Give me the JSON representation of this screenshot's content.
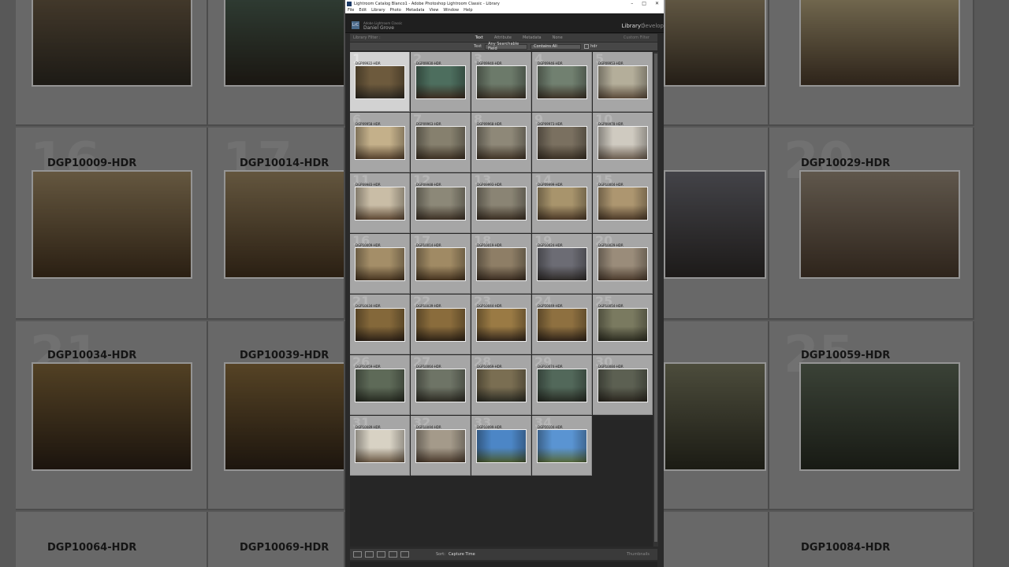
{
  "window": {
    "title": "Lightroom Catalog Blanco1 - Adobe Photoshop Lightroom Classic - Library",
    "controls": [
      "–",
      "□",
      "✕"
    ]
  },
  "menu": [
    "File",
    "Edit",
    "Library",
    "Photo",
    "Metadata",
    "View",
    "Window",
    "Help"
  ],
  "identity": {
    "logo": "LrC",
    "brand": "Adobe Lightroom Classic",
    "user": "Daniel Grove",
    "modules": [
      "Library",
      "|",
      "Develop"
    ]
  },
  "filter_bar": {
    "label": "Library Filter :",
    "tabs": [
      "Text",
      "Attribute",
      "Metadata",
      "None"
    ],
    "active_tab": "Text",
    "preset": "Custom Filter"
  },
  "text_filter": {
    "label": "Text",
    "field": "Any Searchable Field",
    "rule": "Contains All",
    "query": "hdr"
  },
  "grid": {
    "items": [
      {
        "n": "1",
        "name": "DGP09922-HDR",
        "c1": "#6d5a3d",
        "c2": "#2f2a22",
        "sel": true
      },
      {
        "n": "2",
        "name": "DGP09930-HDR",
        "c1": "#4d6e5e",
        "c2": "#3c2c20"
      },
      {
        "n": "3",
        "name": "DGP09940-HDR",
        "c1": "#6c7a6a",
        "c2": "#3e3428"
      },
      {
        "n": "4",
        "name": "DGP09946-HDR",
        "c1": "#718070",
        "c2": "#3c3226"
      },
      {
        "n": "5",
        "name": "DGP09953-HDR",
        "c1": "#b4ae9a",
        "c2": "#5a4a3a"
      },
      {
        "n": "6",
        "name": "DGP09958-HDR",
        "c1": "#c4b08a",
        "c2": "#54402c"
      },
      {
        "n": "7",
        "name": "DGP09963-HDR",
        "c1": "#86806e",
        "c2": "#3c3022"
      },
      {
        "n": "8",
        "name": "DGP09968-HDR",
        "c1": "#8e8878",
        "c2": "#403426"
      },
      {
        "n": "9",
        "name": "DGP09973-HDR",
        "c1": "#7a7060",
        "c2": "#3a3024"
      },
      {
        "n": "10",
        "name": "DGP09978-HDR",
        "c1": "#cfcac0",
        "c2": "#6a5c4e"
      },
      {
        "n": "11",
        "name": "DGP09983-HDR",
        "c1": "#c9bda6",
        "c2": "#5c4632"
      },
      {
        "n": "12",
        "name": "DGP09988-HDR",
        "c1": "#8c8878",
        "c2": "#3c3024"
      },
      {
        "n": "13",
        "name": "DGP09993-HDR",
        "c1": "#8a8474",
        "c2": "#3a2e22"
      },
      {
        "n": "14",
        "name": "DGP09999-HDR",
        "c1": "#a8946c",
        "c2": "#4a3826"
      },
      {
        "n": "15",
        "name": "DGP10004-HDR",
        "c1": "#ad9670",
        "c2": "#4c3a28"
      },
      {
        "n": "16",
        "name": "DGP10009-HDR",
        "c1": "#a48e68",
        "c2": "#463420"
      },
      {
        "n": "17",
        "name": "DGP10014-HDR",
        "c1": "#a08a64",
        "c2": "#44321e"
      },
      {
        "n": "18",
        "name": "DGP10019-HDR",
        "c1": "#8e7e66",
        "c2": "#3a2c20"
      },
      {
        "n": "19",
        "name": "DGP10024-HDR",
        "c1": "#6c6c74",
        "c2": "#2e2a28"
      },
      {
        "n": "20",
        "name": "DGP10029-HDR",
        "c1": "#9a8c7a",
        "c2": "#4a3a2c"
      },
      {
        "n": "21",
        "name": "DGP10034-HDR",
        "c1": "#84683a",
        "c2": "#2c2016"
      },
      {
        "n": "22",
        "name": "DGP10039-HDR",
        "c1": "#8a6c3c",
        "c2": "#2e2216"
      },
      {
        "n": "23",
        "name": "DGP10044-HDR",
        "c1": "#9a7a44",
        "c2": "#30241a"
      },
      {
        "n": "24",
        "name": "DGP10049-HDR",
        "c1": "#8e7040",
        "c2": "#2e2218"
      },
      {
        "n": "25",
        "name": "DGP10054-HDR",
        "c1": "#7a7a60",
        "c2": "#2c2c20"
      },
      {
        "n": "26",
        "name": "DGP10059-HDR",
        "c1": "#5e6a58",
        "c2": "#262a20"
      },
      {
        "n": "27",
        "name": "DGP10064-HDR",
        "c1": "#6e7466",
        "c2": "#2c2a22"
      },
      {
        "n": "28",
        "name": "DGP10069-HDR",
        "c1": "#7a6e52",
        "c2": "#2a2a22"
      },
      {
        "n": "29",
        "name": "DGP10074-HDR",
        "c1": "#52685a",
        "c2": "#262a22"
      },
      {
        "n": "30",
        "name": "DGP10084-HDR",
        "c1": "#5c6052",
        "c2": "#2a261e"
      },
      {
        "n": "31",
        "name": "DGP10089-HDR",
        "c1": "#d8d2c4",
        "c2": "#6a5844"
      },
      {
        "n": "32",
        "name": "DGP10094-HDR",
        "c1": "#a49a8a",
        "c2": "#4a3a2c"
      },
      {
        "n": "33",
        "name": "DGP10099-HDR",
        "c1": "#4c86c6",
        "c2": "#4a5a30"
      },
      {
        "n": "34",
        "name": "DGP10104-HDR",
        "c1": "#5a94d2",
        "c2": "#56683a"
      }
    ]
  },
  "toolbar": {
    "sort_label": "Sort:",
    "sort_value": "Capture Time",
    "thumbnails_label": "Thumbnails"
  },
  "background": {
    "numbers": [
      "16",
      "17",
      "20",
      "21",
      "25"
    ],
    "names": [
      "DGP10009-HDR",
      "DGP10014-HDR",
      "DGP10029-HDR",
      "DGP10034-HDR",
      "DGP10039-HDR",
      "DGP10059-HDR",
      "DGP10064-HDR",
      "DGP10069-HDR",
      "DGP10084-HDR"
    ]
  }
}
